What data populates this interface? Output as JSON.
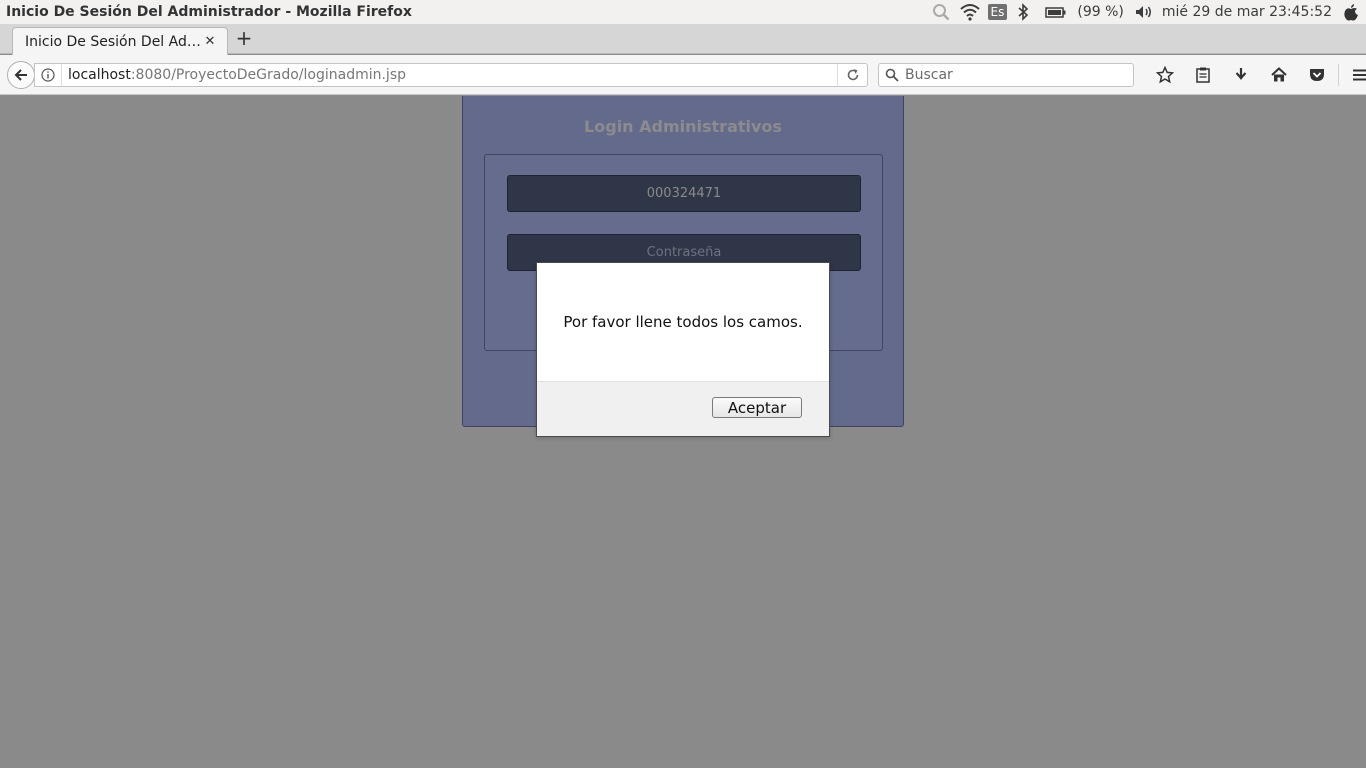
{
  "window": {
    "title": "Inicio De Sesión Del Administrador - Mozilla Firefox"
  },
  "system_tray": {
    "keyboard_layout": "Es",
    "battery": "(99 %)",
    "clock": "mié 29 de mar 23:45:52",
    "icons": [
      "search-icon",
      "wifi-icon",
      "bluetooth-icon",
      "battery-icon",
      "volume-icon",
      "apple-icon"
    ]
  },
  "tabs": [
    {
      "label": "Inicio De Sesión Del Ad…",
      "active": true
    }
  ],
  "navbar": {
    "url_host": "localhost",
    "url_path": ":8080/ProyectoDeGrado/loginadmin.jsp",
    "search_placeholder": "Buscar"
  },
  "login": {
    "title": "Login Administrativos",
    "username_value": "000324471",
    "password_placeholder": "Contraseña"
  },
  "dialog": {
    "message": "Por favor llene todos los camos.",
    "button_label": "Aceptar"
  },
  "colors": {
    "page_bg": "#8a8a8a",
    "login_panel": "#636a8b",
    "input_bg": "#2f3647"
  }
}
